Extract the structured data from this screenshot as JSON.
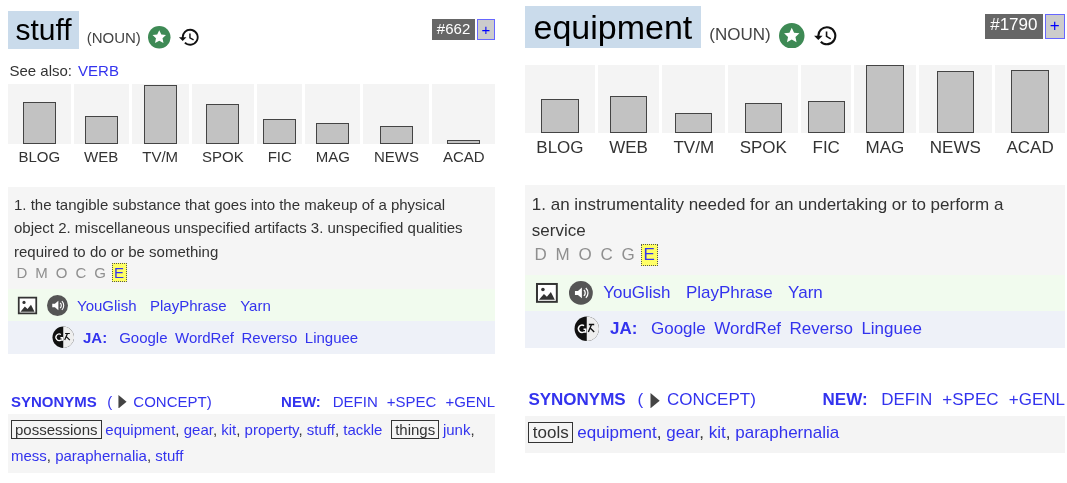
{
  "panels": [
    {
      "word": "stuff",
      "pos": "(NOUN)",
      "rank": "#662",
      "add": "+",
      "see_also": {
        "label": "See also:",
        "link": "VERB"
      },
      "genres": [
        {
          "label": "BLOG"
        },
        {
          "label": "WEB"
        },
        {
          "label": "TV/M"
        },
        {
          "label": "SPOK"
        },
        {
          "label": "FIC"
        },
        {
          "label": "MAG"
        },
        {
          "label": "NEWS"
        },
        {
          "label": "ACAD"
        }
      ],
      "definition": "1. the tangible substance that goes into the makeup of a physical object 2. miscellaneous unspecified artifacts 3. unspecified qualities required to do or be something",
      "sources": [
        {
          "letter": "D",
          "selected": false
        },
        {
          "letter": "M",
          "selected": false
        },
        {
          "letter": "O",
          "selected": false
        },
        {
          "letter": "C",
          "selected": false
        },
        {
          "letter": "G",
          "selected": false
        },
        {
          "letter": "E",
          "selected": true
        }
      ],
      "media_links": [
        "YouGlish",
        "PlayPhrase",
        "Yarn"
      ],
      "translate": {
        "lang": "JA:",
        "links": [
          "Google",
          "WordRef",
          "Reverso",
          "Linguee"
        ]
      },
      "synonyms": {
        "title": "SYNONYMS",
        "open": "(",
        "concept": "CONCEPT)",
        "new_label": "NEW:",
        "actions": [
          "DEFIN",
          "+SPEC",
          "+GENL"
        ],
        "separator": ",",
        "groups": [
          {
            "head": "possessions",
            "words": [
              "equipment",
              "gear",
              "kit",
              "property",
              "stuff",
              "tackle"
            ]
          },
          {
            "head": "things",
            "words": [
              "junk",
              "mess",
              "paraphernalia",
              "stuff"
            ]
          }
        ]
      }
    },
    {
      "word": "equipment",
      "pos": "(NOUN)",
      "rank": "#1790",
      "add": "+",
      "genres": [
        {
          "label": "BLOG"
        },
        {
          "label": "WEB"
        },
        {
          "label": "TV/M"
        },
        {
          "label": "SPOK"
        },
        {
          "label": "FIC"
        },
        {
          "label": "MAG"
        },
        {
          "label": "NEWS"
        },
        {
          "label": "ACAD"
        }
      ],
      "definition": "1. an instrumentality needed for an undertaking or to perform a service",
      "sources": [
        {
          "letter": "D",
          "selected": false
        },
        {
          "letter": "M",
          "selected": false
        },
        {
          "letter": "O",
          "selected": false
        },
        {
          "letter": "C",
          "selected": false
        },
        {
          "letter": "G",
          "selected": false
        },
        {
          "letter": "E",
          "selected": true
        }
      ],
      "media_links": [
        "YouGlish",
        "PlayPhrase",
        "Yarn"
      ],
      "translate": {
        "lang": "JA:",
        "links": [
          "Google",
          "WordRef",
          "Reverso",
          "Linguee"
        ]
      },
      "synonyms": {
        "title": "SYNONYMS",
        "open": "(",
        "concept": "CONCEPT)",
        "new_label": "NEW:",
        "actions": [
          "DEFIN",
          "+SPEC",
          "+GENL"
        ],
        "separator": ",",
        "groups": [
          {
            "head": "tools",
            "words": [
              "equipment",
              "gear",
              "kit",
              "paraphernalia"
            ]
          }
        ]
      }
    }
  ]
}
